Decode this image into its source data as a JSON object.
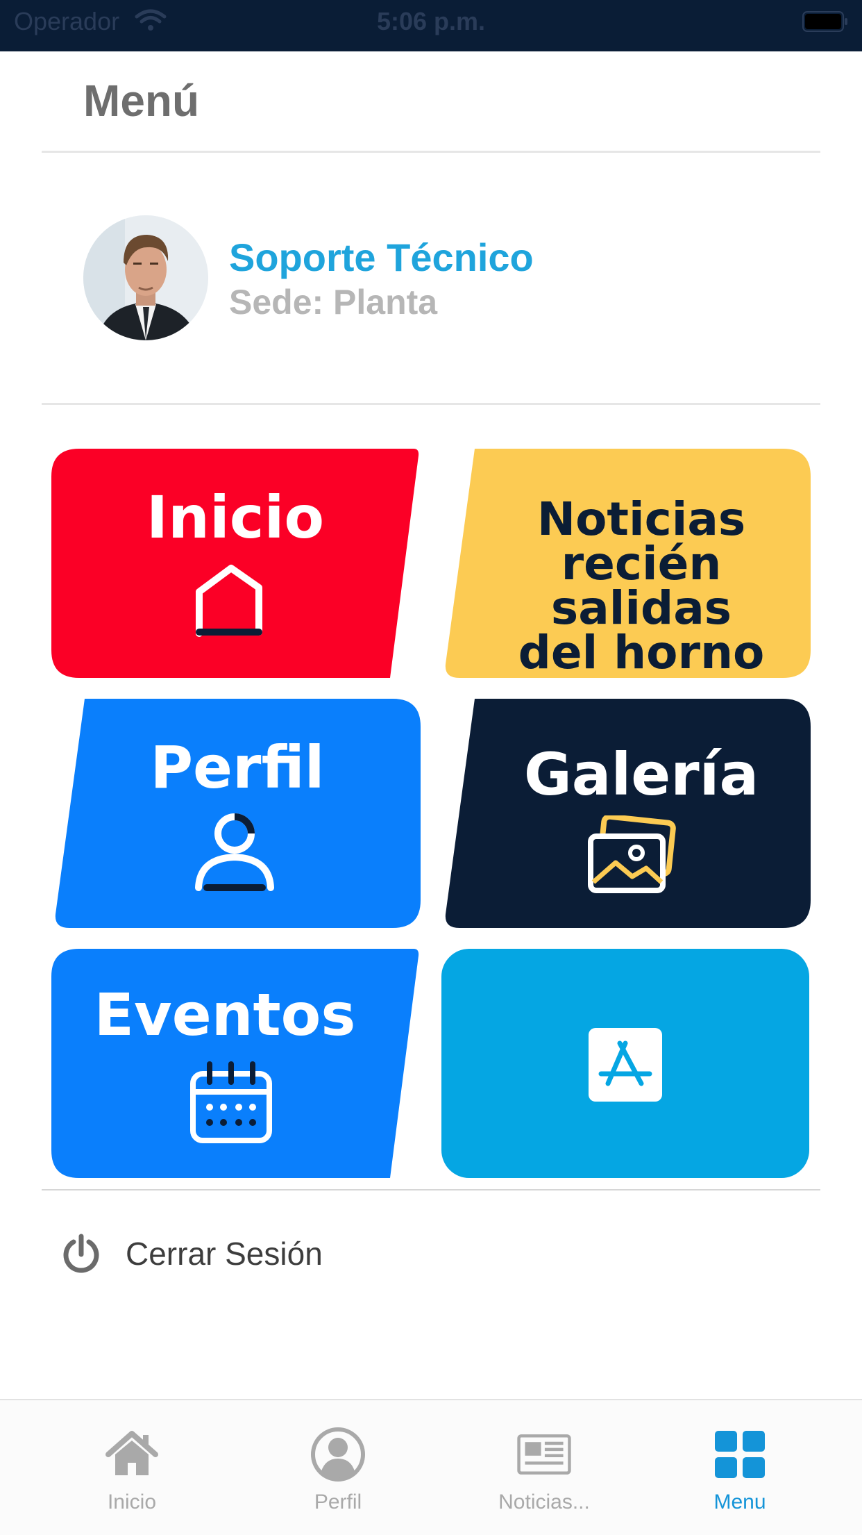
{
  "status_bar": {
    "carrier": "Operador",
    "time": "5:06 p.m."
  },
  "header": {
    "title": "Menú"
  },
  "profile": {
    "name": "Soporte Técnico",
    "sede": "Sede: Planta"
  },
  "tiles": [
    {
      "label": "Inicio",
      "color": "#fb0026",
      "text_color": "#ffffff",
      "icon": "home-outline-icon"
    },
    {
      "label_lines": [
        "Noticias",
        "recién salidas",
        "del horno"
      ],
      "color": "#fccb53",
      "text_color": "#0b1d35",
      "icon": "none"
    },
    {
      "label": "Perfil",
      "color": "#0a7ffc",
      "text_color": "#ffffff",
      "icon": "user-outline-icon"
    },
    {
      "label": "Galería",
      "color": "#0b1d36",
      "text_color": "#ffffff",
      "icon": "gallery-icon"
    },
    {
      "label": "Eventos",
      "color": "#0a7ffc",
      "text_color": "#ffffff",
      "icon": "calendar-icon"
    },
    {
      "label": "",
      "color": "#05a6e3",
      "text_color": "#ffffff",
      "icon": "app-store-icon"
    }
  ],
  "logout": {
    "label": "Cerrar Sesión",
    "icon": "power-icon"
  },
  "tab_bar": {
    "items": [
      {
        "label": "Inicio",
        "icon": "home-icon",
        "active": false
      },
      {
        "label": "Perfil",
        "icon": "user-circle-icon",
        "active": false
      },
      {
        "label": "Noticias...",
        "icon": "newspaper-icon",
        "active": false
      },
      {
        "label": "Menu",
        "icon": "grid-icon",
        "active": true
      }
    ],
    "active_color": "#1494d8",
    "inactive_color": "#a9a9a9"
  }
}
